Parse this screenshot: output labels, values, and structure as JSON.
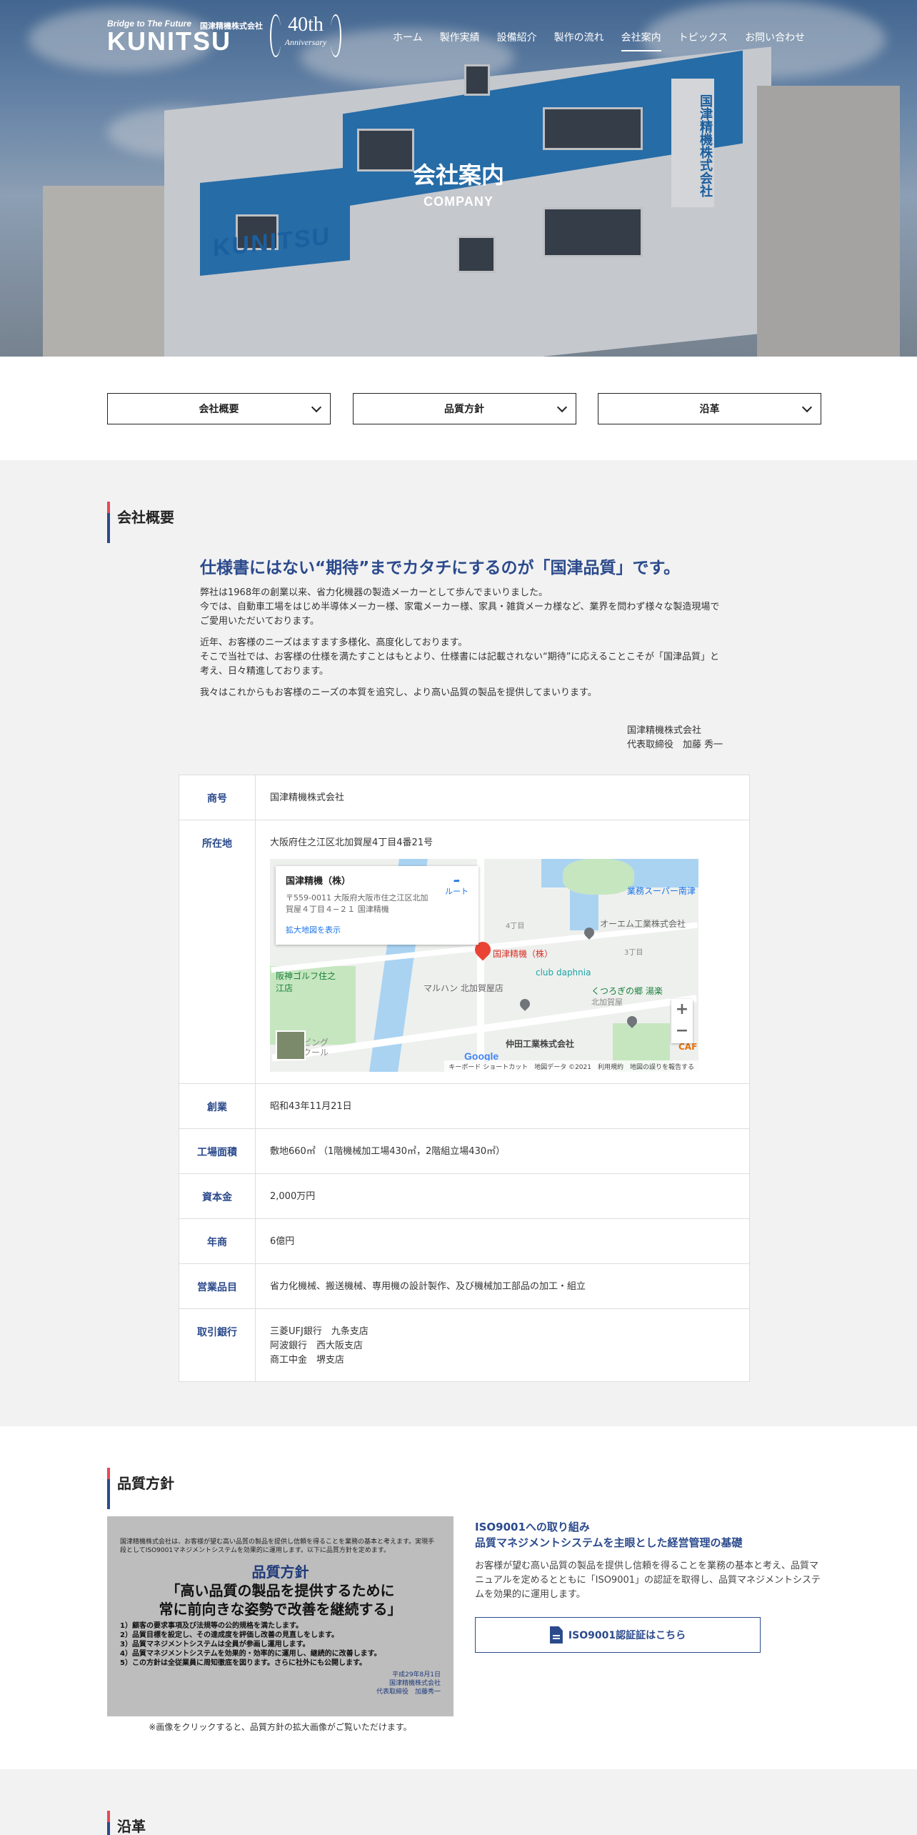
{
  "brand": {
    "tagline": "Bridge to The Future",
    "company_jp": "国津精機株式会社",
    "logo": "KUNITSU",
    "anniversary_number": "40th",
    "anniversary_word": "Anniversary"
  },
  "nav": [
    "ホーム",
    "製作実績",
    "設備紹介",
    "製作の流れ",
    "会社案内",
    "トピックス",
    "お問い合わせ"
  ],
  "nav_active_index": 4,
  "hero": {
    "title": "会社案内",
    "subtitle": "COMPANY",
    "building_logo": "KUNITSU",
    "building_sign": "国津精機株式会社"
  },
  "anchors": [
    "会社概要",
    "品質方針",
    "沿革"
  ],
  "overview": {
    "heading": "会社概要",
    "catch": "仕様書にはない“期待”までカタチにするのが「国津品質」です。",
    "paragraphs": [
      "弊社は1968年の創業以来、省力化機器の製造メーカーとして歩んでまいりました。\n今では、自動車工場をはじめ半導体メーカー様、家電メーカー様、家具・雑貨メーカ様など、業界を問わず様々な製造現場でご愛用いただいております。",
      "近年、お客様のニーズはますます多様化、高度化しております。\nそこで当社では、お客様の仕様を満たすことはもとより、仕様書には記載されない“期待”に応えることこそが「国津品質」と考え、日々精進しております。",
      "我々はこれからもお客様のニーズの本質を追究し、より高い品質の製品を提供してまいります。"
    ],
    "sign_company": "国津精機株式会社",
    "sign_person": "代表取締役　加藤 秀一"
  },
  "table": [
    {
      "label": "商号",
      "value": "国津精機株式会社"
    },
    {
      "label": "所在地",
      "value": "大阪府住之江区北加賀屋4丁目4番21号"
    },
    {
      "label": "創業",
      "value": "昭和43年11月21日"
    },
    {
      "label": "工場面積",
      "value": "敷地660㎡ （1階機械加工場430㎡，2階組立場430㎡）"
    },
    {
      "label": "資本金",
      "value": "2,000万円"
    },
    {
      "label": "年商",
      "value": "6億円"
    },
    {
      "label": "営業品目",
      "value": "省力化機械、搬送機械、専用機の設計製作、及び機械加工部品の加工・組立"
    },
    {
      "label": "取引銀行",
      "value": "三菱UFJ銀行　九条支店\n阿波銀行　西大阪支店\n商工中金　堺支店"
    }
  ],
  "map": {
    "place_name": "国津精機（株）",
    "address": "〒559-0011 大阪府大阪市住之江区北加賀屋４丁目４−２１ 国津精機",
    "route_label": "ルート",
    "enlarge_link": "拡大地図を表示",
    "labels": [
      "業務スーパー南津",
      "オーエム工業株式会社",
      "club daphnia",
      "マルハン 北加賀屋店",
      "北加賀屋",
      "くつろぎの郷 湯楽",
      "仲田工業株式会社",
      "阪神ゴルフ住之江店",
      "3丁目",
      "4丁目",
      "ビング",
      "クール",
      "CAF",
      "国津精機（株）"
    ],
    "zoom_in": "+",
    "zoom_out": "−",
    "footer": "キーボード ショートカット　地図データ ©2021　利用規約　地図の誤りを報告する",
    "google": "Google"
  },
  "quality": {
    "heading": "品質方針",
    "image_intro": "国津精機株式会社は、お客様が望む高い品質の製品を提供し信頼を得ることを業務の基本と考えます。実現手段としてISO9001マネジメントシステムを効果的に運用します。以下に品質方針を定めます。",
    "image_title": "品質方針",
    "image_slogan": "「高い品質の製品を提供するために\n常に前向きな姿勢で改善を継続する」",
    "image_list": [
      "1）顧客の要求事項及び法規等の公的規格を満たします。",
      "2）品質目標を設定し、その達成度を評価し改善の見直しをします。",
      "3）品質マネジメントシステムは全員が参画し運用します。",
      "4）品質マネジメントシステムを効果的・効率的に運用し、継続的に改善します。",
      "5）この方針は全従業員に周知徹底を図ります。さらに社外にも公開します。"
    ],
    "image_sign": "平成29年8月1日\n国津精機株式会社\n代表取締役　加藤秀一",
    "note": "※画像をクリックすると、品質方針の拡大画像がご覧いただけます。",
    "title_line1": "ISO9001への取り組み",
    "title_line2": "品質マネジメントシステムを主眼とした経営管理の基礎",
    "body": "お客様が望む高い品質の製品を提供し信頼を得ることを業務の基本と考え、品質マニュアルを定めるとともに「ISO9001」の認証を取得し、品質マネジメントシステムを効果的に運用します。",
    "button": "ISO9001認証証はこちら"
  },
  "history": {
    "heading": "沿革"
  }
}
